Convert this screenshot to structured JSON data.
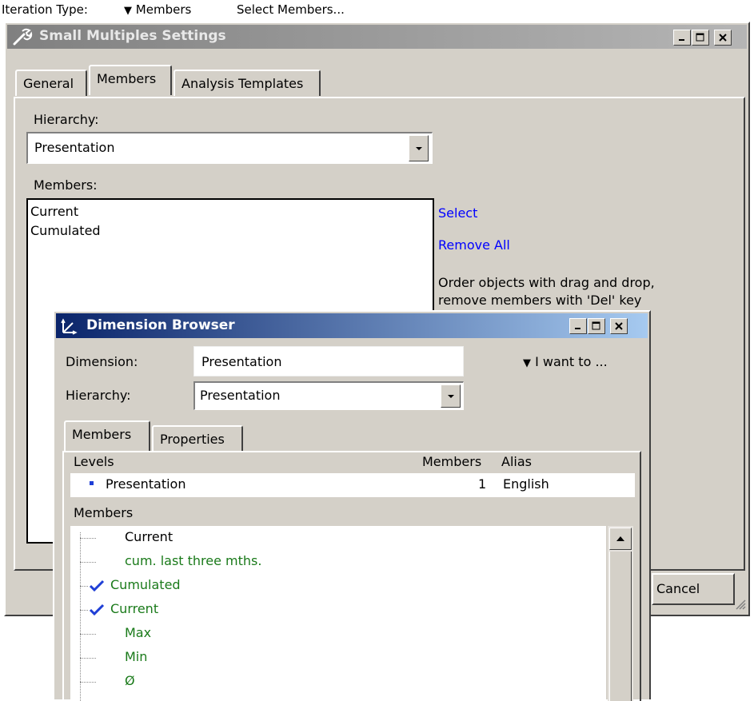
{
  "toolbar": {
    "iteration_type_label": "Iteration Type:",
    "members_dropdown": "Members",
    "select_members": "Select Members..."
  },
  "settings_window": {
    "title": "Small Multiples Settings",
    "tabs": [
      {
        "label": "General"
      },
      {
        "label": "Members"
      },
      {
        "label": "Analysis Templates"
      }
    ],
    "active_tab": "Members",
    "hierarchy_label": "Hierarchy:",
    "hierarchy_value": "Presentation",
    "members_label": "Members:",
    "members_list": [
      "Current",
      "Cumulated"
    ],
    "select_link": "Select",
    "remove_all_link": "Remove All",
    "hint_line1": "Order objects with drag and drop,",
    "hint_line2": "remove members with 'Del' key",
    "cancel_button": "Cancel"
  },
  "dimension_browser": {
    "title": "Dimension Browser",
    "dimension_label": "Dimension:",
    "dimension_value": "Presentation",
    "i_want_to": "I want to ...",
    "hierarchy_label": "Hierarchy:",
    "hierarchy_value": "Presentation",
    "tabs": [
      {
        "label": "Members"
      },
      {
        "label": "Properties"
      }
    ],
    "levels_header": {
      "levels": "Levels",
      "members": "Members",
      "alias": "Alias"
    },
    "levels": [
      {
        "name": "Presentation",
        "members": "1",
        "alias": "English"
      }
    ],
    "members_header": "Members",
    "tree": [
      {
        "label": "Current",
        "checked": false,
        "color": "#000000"
      },
      {
        "label": "cum. last three mths.",
        "checked": false,
        "color": "#1a7a1a"
      },
      {
        "label": "Cumulated",
        "checked": true,
        "color": "#1a7a1a"
      },
      {
        "label": "Current",
        "checked": true,
        "color": "#1a7a1a"
      },
      {
        "label": "Max",
        "checked": false,
        "color": "#1a7a1a"
      },
      {
        "label": "Min",
        "checked": false,
        "color": "#1a7a1a"
      },
      {
        "label": "Ø",
        "checked": false,
        "color": "#1a7a1a"
      }
    ]
  },
  "colors": {
    "dialog_bg": "#d4d0c8",
    "active_title": "#0a246a",
    "inactive_title": "#808080",
    "link": "#0000ff",
    "green_member": "#1a7a1a",
    "check": "#1f3fd6"
  }
}
